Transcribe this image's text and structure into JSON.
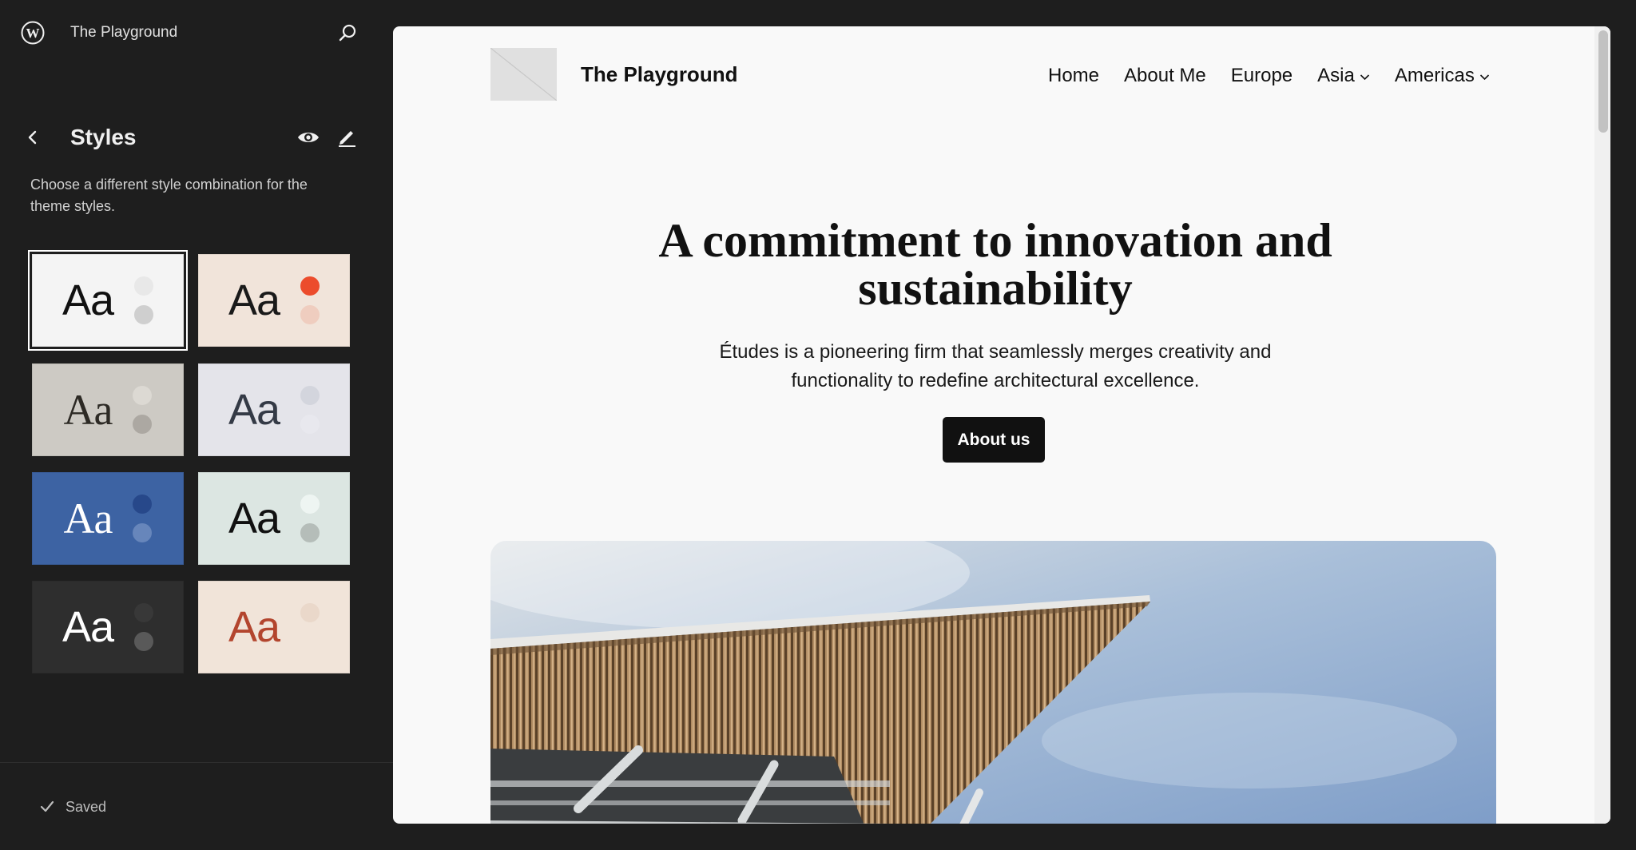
{
  "sidebar": {
    "site_title": "The Playground",
    "styles_title": "Styles",
    "description": "Choose a different style combination for the theme styles.",
    "saved_label": "Saved",
    "variations": [
      {
        "aa": "Aa",
        "bg": "#f4f4f4",
        "aa_color": "#111111",
        "dot1": "#e8e8e8",
        "dot2": "#cfcfcf",
        "serif": false,
        "active": true
      },
      {
        "aa": "Aa",
        "bg": "#f1e4da",
        "aa_color": "#1a1a1a",
        "dot1": "#ec4c2c",
        "dot2": "#efcdbf",
        "serif": false,
        "active": false
      },
      {
        "aa": "Aa",
        "bg": "#cdcac4",
        "aa_color": "#2d2a25",
        "dot1": "#dcd9d3",
        "dot2": "#aca8a2",
        "serif": true,
        "active": false
      },
      {
        "aa": "Aa",
        "bg": "#e4e4ea",
        "aa_color": "#343a46",
        "dot1": "#d3d5dd",
        "dot2": "#e8e8ee",
        "serif": false,
        "active": false
      },
      {
        "aa": "Aa",
        "bg": "#3d63a3",
        "aa_color": "#ffffff",
        "dot1": "#27488a",
        "dot2": "#6786bb",
        "serif": true,
        "active": false
      },
      {
        "aa": "Aa",
        "bg": "#dce6e2",
        "aa_color": "#111111",
        "dot1": "#eef5f2",
        "dot2": "#b5bdb9",
        "serif": false,
        "active": false
      },
      {
        "aa": "Aa",
        "bg": "#2e2e2e",
        "aa_color": "#ffffff",
        "dot1": "#383838",
        "dot2": "#595959",
        "serif": false,
        "active": false
      },
      {
        "aa": "Aa",
        "bg": "#f1e4d9",
        "aa_color": "#b3452e",
        "dot1": "#ead8ca",
        "dot2": "#f1e4d9",
        "serif": false,
        "active": false
      }
    ]
  },
  "preview": {
    "site_title": "The Playground",
    "nav": [
      {
        "label": "Home",
        "submenu": false
      },
      {
        "label": "About Me",
        "submenu": false
      },
      {
        "label": "Europe",
        "submenu": false
      },
      {
        "label": "Asia",
        "submenu": true
      },
      {
        "label": "Americas",
        "submenu": true
      }
    ],
    "heading": "A commitment to innovation and sustainability",
    "text": "Études is a pioneering firm that seamlessly merges creativity and functionality to redefine architectural excellence.",
    "button_label": "About us"
  },
  "icons": [
    "wordpress-logo-icon",
    "search-icon",
    "chevron-left-icon",
    "eye-icon",
    "pencil-icon",
    "check-icon",
    "chevron-down-icon"
  ]
}
